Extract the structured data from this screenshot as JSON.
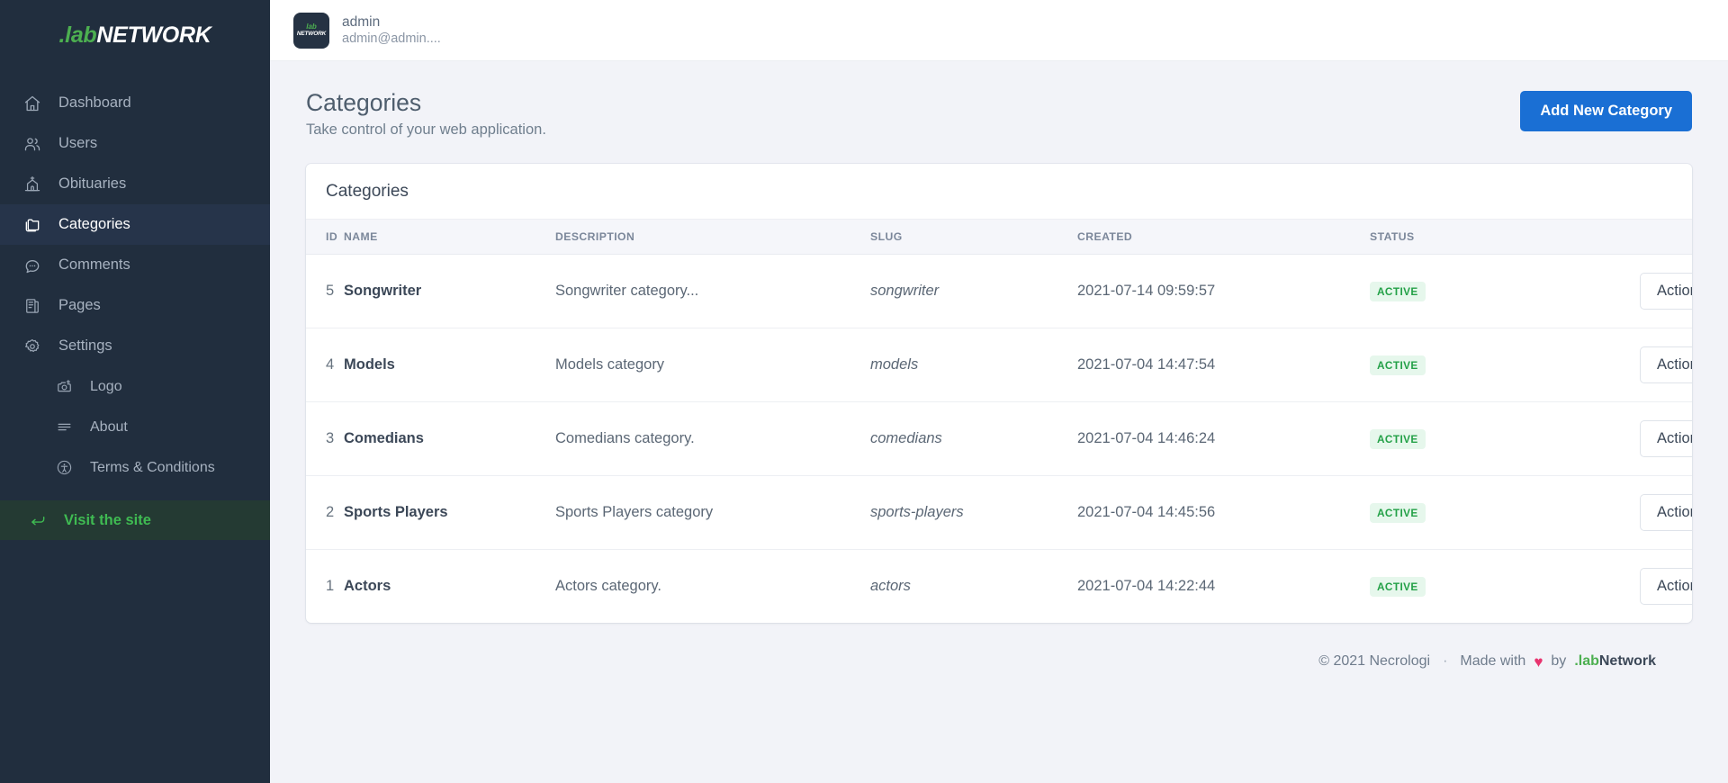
{
  "brand": {
    "prefix": ".lab",
    "suffix": "NETWORK"
  },
  "sidebar": {
    "items": [
      {
        "label": "Dashboard",
        "icon": "home-icon",
        "level": "top",
        "active": false
      },
      {
        "label": "Users",
        "icon": "users-icon",
        "level": "top",
        "active": false
      },
      {
        "label": "Obituaries",
        "icon": "church-icon",
        "level": "top",
        "active": false
      },
      {
        "label": "Categories",
        "icon": "folders-icon",
        "level": "top",
        "active": true
      },
      {
        "label": "Comments",
        "icon": "comment-icon",
        "level": "top",
        "active": false
      },
      {
        "label": "Pages",
        "icon": "pages-icon",
        "level": "top",
        "active": false
      },
      {
        "label": "Settings",
        "icon": "gear-icon",
        "level": "top",
        "active": false
      },
      {
        "label": "Logo",
        "icon": "camera-plus-icon",
        "level": "sub",
        "active": false
      },
      {
        "label": "About",
        "icon": "lines-icon",
        "level": "sub",
        "active": false
      },
      {
        "label": "Terms & Conditions",
        "icon": "accessibility-icon",
        "level": "sub",
        "active": false
      }
    ],
    "visit_site": {
      "label": "Visit the site",
      "icon": "arrow-return-icon"
    }
  },
  "topbar": {
    "user_name": "admin",
    "user_email": "admin@admin....",
    "avatar_line1": "lab",
    "avatar_line2": "NETWORK"
  },
  "page": {
    "title": "Categories",
    "subtitle": "Take control of your web application.",
    "add_button": "Add New Category"
  },
  "table": {
    "card_title": "Categories",
    "columns": [
      "ID",
      "NAME",
      "DESCRIPTION",
      "SLUG",
      "CREATED",
      "STATUS"
    ],
    "actions_label": "Actions",
    "rows": [
      {
        "id": "5",
        "name": "Songwriter",
        "description": "Songwriter category...",
        "slug": "songwriter",
        "created": "2021-07-14 09:59:57",
        "status": "ACTIVE"
      },
      {
        "id": "4",
        "name": "Models",
        "description": "Models category",
        "slug": "models",
        "created": "2021-07-04 14:47:54",
        "status": "ACTIVE"
      },
      {
        "id": "3",
        "name": "Comedians",
        "description": "Comedians category.",
        "slug": "comedians",
        "created": "2021-07-04 14:46:24",
        "status": "ACTIVE"
      },
      {
        "id": "2",
        "name": "Sports Players",
        "description": "Sports Players category",
        "slug": "sports-players",
        "created": "2021-07-04 14:45:56",
        "status": "ACTIVE"
      },
      {
        "id": "1",
        "name": "Actors",
        "description": "Actors category.",
        "slug": "actors",
        "created": "2021-07-04 14:22:44",
        "status": "ACTIVE"
      }
    ]
  },
  "footer": {
    "copyright": "© 2021 Necrologi",
    "separator": "·",
    "made_with": "Made with",
    "heart": "♥",
    "by": "by",
    "brand_prefix": ".lab",
    "brand_suffix": "Network"
  },
  "colors": {
    "sidebar_bg": "#212e3e",
    "sidebar_active": "#26344a",
    "accent_green": "#4caf50",
    "primary_blue": "#1a6fd4",
    "badge_green": "#24a148",
    "heart_pink": "#e8346f"
  }
}
